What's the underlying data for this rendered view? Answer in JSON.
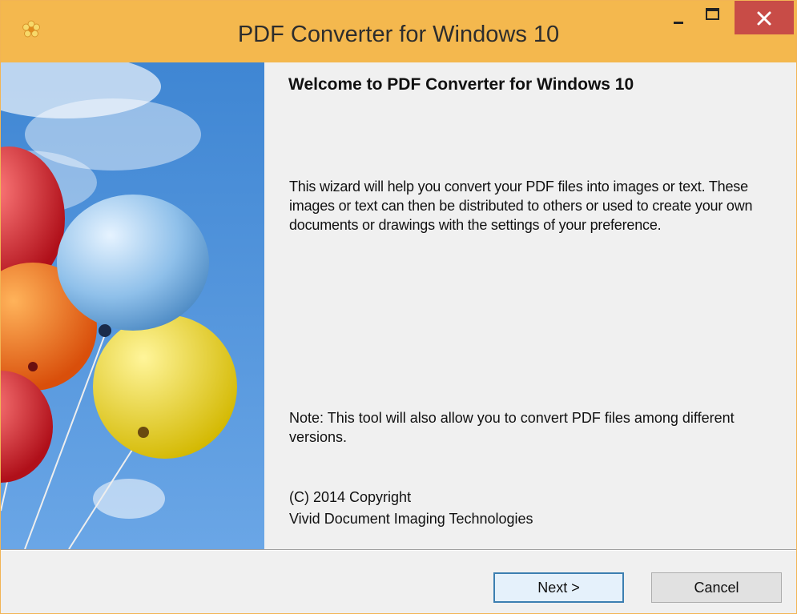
{
  "window": {
    "title": "PDF Converter for Windows 10"
  },
  "content": {
    "heading": "Welcome to PDF Converter for Windows 10",
    "intro": "This wizard will help you convert your PDF files into images or text. These images or text can then be distributed to others or used to create your own documents or drawings with the settings of your preference.",
    "note": "Note: This tool will also allow you to convert PDF files among different versions.",
    "copyright": "(C) 2014 Copyright",
    "company": "Vivid Document Imaging Technologies"
  },
  "buttons": {
    "next": "Next >",
    "cancel": "Cancel"
  },
  "icons": {
    "app": "flower-icon",
    "minimize": "minimize-icon",
    "maximize": "maximize-icon",
    "close": "close-icon"
  },
  "colors": {
    "titlebar": "#f4b84e",
    "close_button": "#c84c47",
    "sky": "#4b8fd6"
  }
}
